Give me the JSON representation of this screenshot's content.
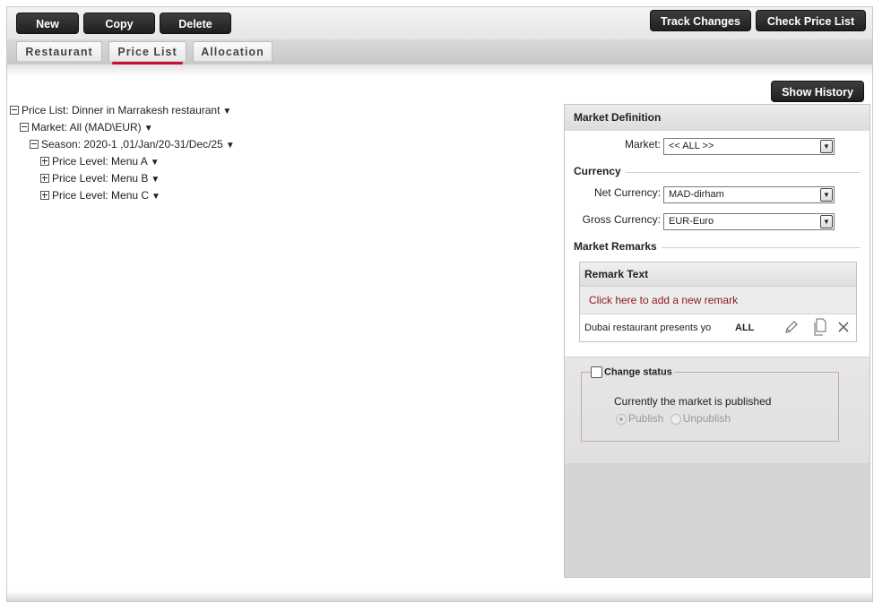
{
  "toolbar": {
    "new_label": "New",
    "copy_label": "Copy",
    "delete_label": "Delete",
    "track_changes_label": "Track Changes",
    "check_price_list_label": "Check Price List"
  },
  "tabs": [
    {
      "label": "Restaurant",
      "active": false
    },
    {
      "label": "Price List",
      "active": true
    },
    {
      "label": "Allocation",
      "active": false
    }
  ],
  "show_history_label": "Show History",
  "tree": {
    "price_list": "Price List: Dinner in Marrakesh restaurant",
    "market": "Market: All (MAD\\EUR)",
    "season": "Season: 2020-1 ,01/Jan/20-31/Dec/25",
    "levels": [
      "Price Level: Menu A",
      "Price Level: Menu B",
      "Price Level: Menu C"
    ]
  },
  "market_definition": {
    "title": "Market Definition",
    "market_label": "Market:",
    "market_value": "<< ALL >>",
    "currency_title": "Currency",
    "net_currency_label": "Net Currency:",
    "net_currency_value": "MAD-dirham",
    "gross_currency_label": "Gross Currency:",
    "gross_currency_value": "EUR-Euro",
    "remarks_title": "Market Remarks",
    "remark_text_header": "Remark Text",
    "add_remark": "Click here to add a new remark",
    "remarks": [
      {
        "text": "Dubai restaurant presents yo",
        "market": "ALL"
      }
    ]
  },
  "status": {
    "change_status_label": "Change status",
    "change_status_checked": false,
    "message": "Currently the market is published",
    "publish_label": "Publish",
    "unpublish_label": "Unpublish"
  },
  "colors": {
    "accent": "#c8102e",
    "remark_link": "#8b1a1a",
    "button_dark": "#2a2a2a"
  }
}
